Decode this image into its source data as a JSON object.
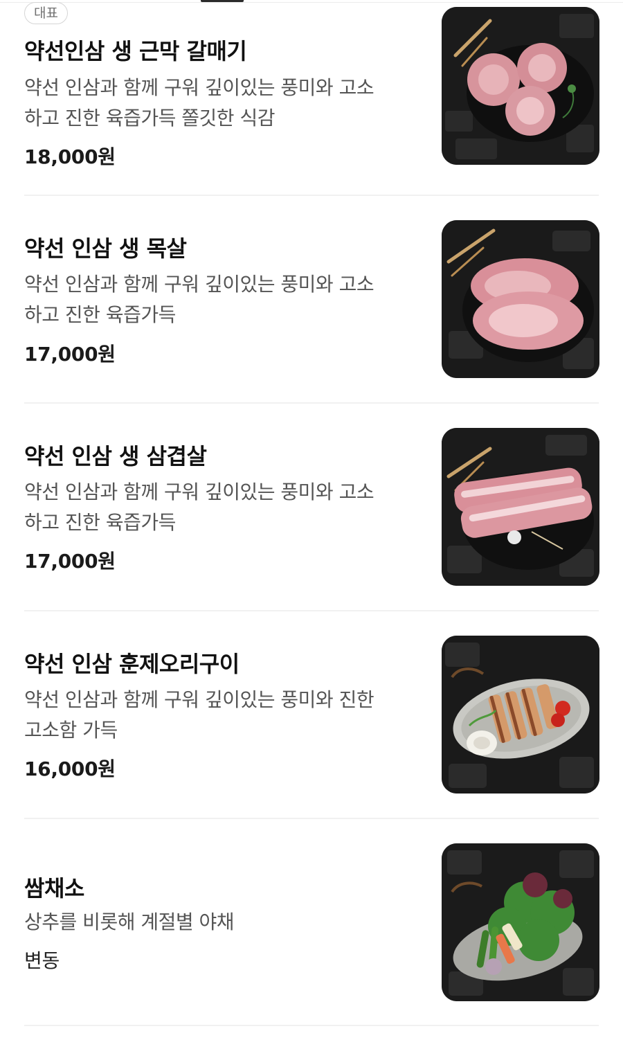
{
  "menu": {
    "items": [
      {
        "badge": "대표",
        "name": "약선인삼 생 근막 갈매기",
        "desc_line1": "약선 인삼과 함께 구워 깊이있는 풍미와 고소",
        "desc_line2": "하고 진한 육즙가득 쫄깃한 식감",
        "price": "18,000원",
        "image_icon": "pork-skirt-rolls-photo"
      },
      {
        "name": "약선 인삼 생 목살",
        "desc_line1": "약선 인삼과 함께 구워 깊이있는 풍미와 고소",
        "desc_line2": "하고 진한 육즙가득",
        "price": "17,000원",
        "image_icon": "pork-neck-photo"
      },
      {
        "name": "약선 인삼 생 삼겹살",
        "desc_line1": "약선 인삼과 함께 구워 깊이있는 풍미와 고소",
        "desc_line2": "하고 진한 육즙가득",
        "price": "17,000원",
        "image_icon": "pork-belly-photo"
      },
      {
        "name": "약선 인삼 훈제오리구이",
        "desc_line1": "약선 인삼과 함께 구워 깊이있는 풍미와 진한",
        "desc_line2": "고소함 가득",
        "price": "16,000원",
        "image_icon": "smoked-duck-photo"
      },
      {
        "name": "쌈채소",
        "desc_line1": "상추를 비롯해 계절별 야채",
        "price": "변동",
        "image_icon": "vegetables-photo"
      }
    ]
  },
  "colors": {
    "text_primary": "#111111",
    "text_secondary": "#545454",
    "divider": "#f1f1f1",
    "badge_border": "#d5d5d5"
  }
}
